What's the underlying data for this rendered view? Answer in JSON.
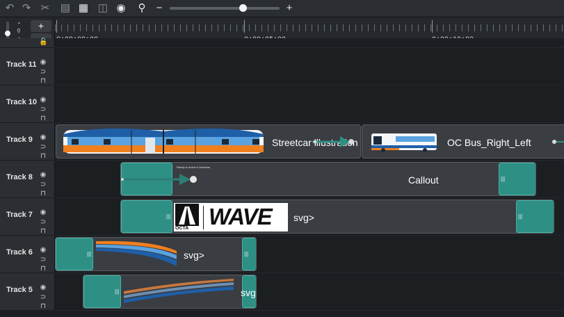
{
  "toolbar": {
    "icons": [
      "undo-icon",
      "redo-icon",
      "cut-icon",
      "copy-icon",
      "paste-icon",
      "split-icon",
      "snapshot-icon",
      "zoom-icon"
    ],
    "zoom_minus": "−",
    "zoom_plus": "+",
    "zoom_level": 0.67
  },
  "left_controls": {
    "add": "+",
    "expand": "⌄"
  },
  "ruler": {
    "labels": [
      "0:00:00;00",
      "0:00:05;00",
      "0:00:10;00"
    ]
  },
  "tracks": [
    {
      "name": "Track 11"
    },
    {
      "name": "Track 10"
    },
    {
      "name": "Track 9"
    },
    {
      "name": "Track 8"
    },
    {
      "name": "Track 7"
    },
    {
      "name": "Track 6"
    },
    {
      "name": "Track 5"
    }
  ],
  "clips": {
    "streetcar": "Streetcar illustration",
    "bus": "OC Bus_Right_Left",
    "callout": "Callout",
    "svg7": "svg>",
    "svg6": "svg>",
    "svg5": "svg",
    "callout_small_text": "Ready to arrive in Anaheim",
    "wave_text": "WAVE",
    "octa_text": "OCTA"
  },
  "colors": {
    "teal": "#2e8f85",
    "lane": "#1c1f22",
    "header": "#2b2e32",
    "accent_orange": "#f07f1e",
    "accent_blue": "#1f5fa8"
  }
}
